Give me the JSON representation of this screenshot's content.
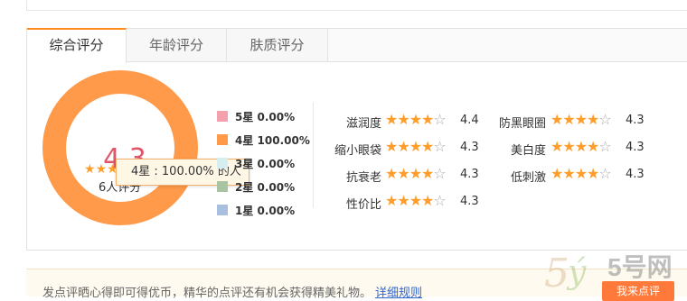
{
  "tabs": [
    {
      "label": "综合评分",
      "active": true
    },
    {
      "label": "年龄评分",
      "active": false
    },
    {
      "label": "肤质评分",
      "active": false
    }
  ],
  "summary": {
    "score": "4.3",
    "star_rating": 4.3,
    "count_label": "6人评分"
  },
  "tooltip": {
    "text": "4星 : 100.00% 的人"
  },
  "distribution": [
    {
      "label": "5星 0.00%",
      "percent": 0,
      "color": "#f4a1ad"
    },
    {
      "label": "4星 100.00%",
      "percent": 100,
      "color": "#ff9a4a"
    },
    {
      "label": "3星 0.00%",
      "percent": 0,
      "color": "#d7eef0"
    },
    {
      "label": "2星 0.00%",
      "percent": 0,
      "color": "#a9c4a3"
    },
    {
      "label": "1星 0.00%",
      "percent": 0,
      "color": "#a9bfe0"
    }
  ],
  "ratings": [
    {
      "name": "滋润度",
      "value": "4.4",
      "stars": 4.4
    },
    {
      "name": "防黑眼圈",
      "value": "4.3",
      "stars": 4.3
    },
    {
      "name": "缩小眼袋",
      "value": "4.3",
      "stars": 4.3
    },
    {
      "name": "美白度",
      "value": "4.3",
      "stars": 4.3
    },
    {
      "name": "抗衰老",
      "value": "4.3",
      "stars": 4.3
    },
    {
      "name": "低刺激",
      "value": "4.3",
      "stars": 4.3
    },
    {
      "name": "性价比",
      "value": "4.3",
      "stars": 4.3
    }
  ],
  "notice": {
    "text": "发点评晒心得即可得优币，精华的点评还有机会获得精美礼物。",
    "link": "详细规则",
    "button": "我来点评"
  },
  "watermark": {
    "text": "5号网"
  },
  "colors": {
    "accent": "#ff8a1f",
    "star": "#ff9d2b",
    "score": "#e0556a",
    "donut": "#ff9a4a"
  }
}
